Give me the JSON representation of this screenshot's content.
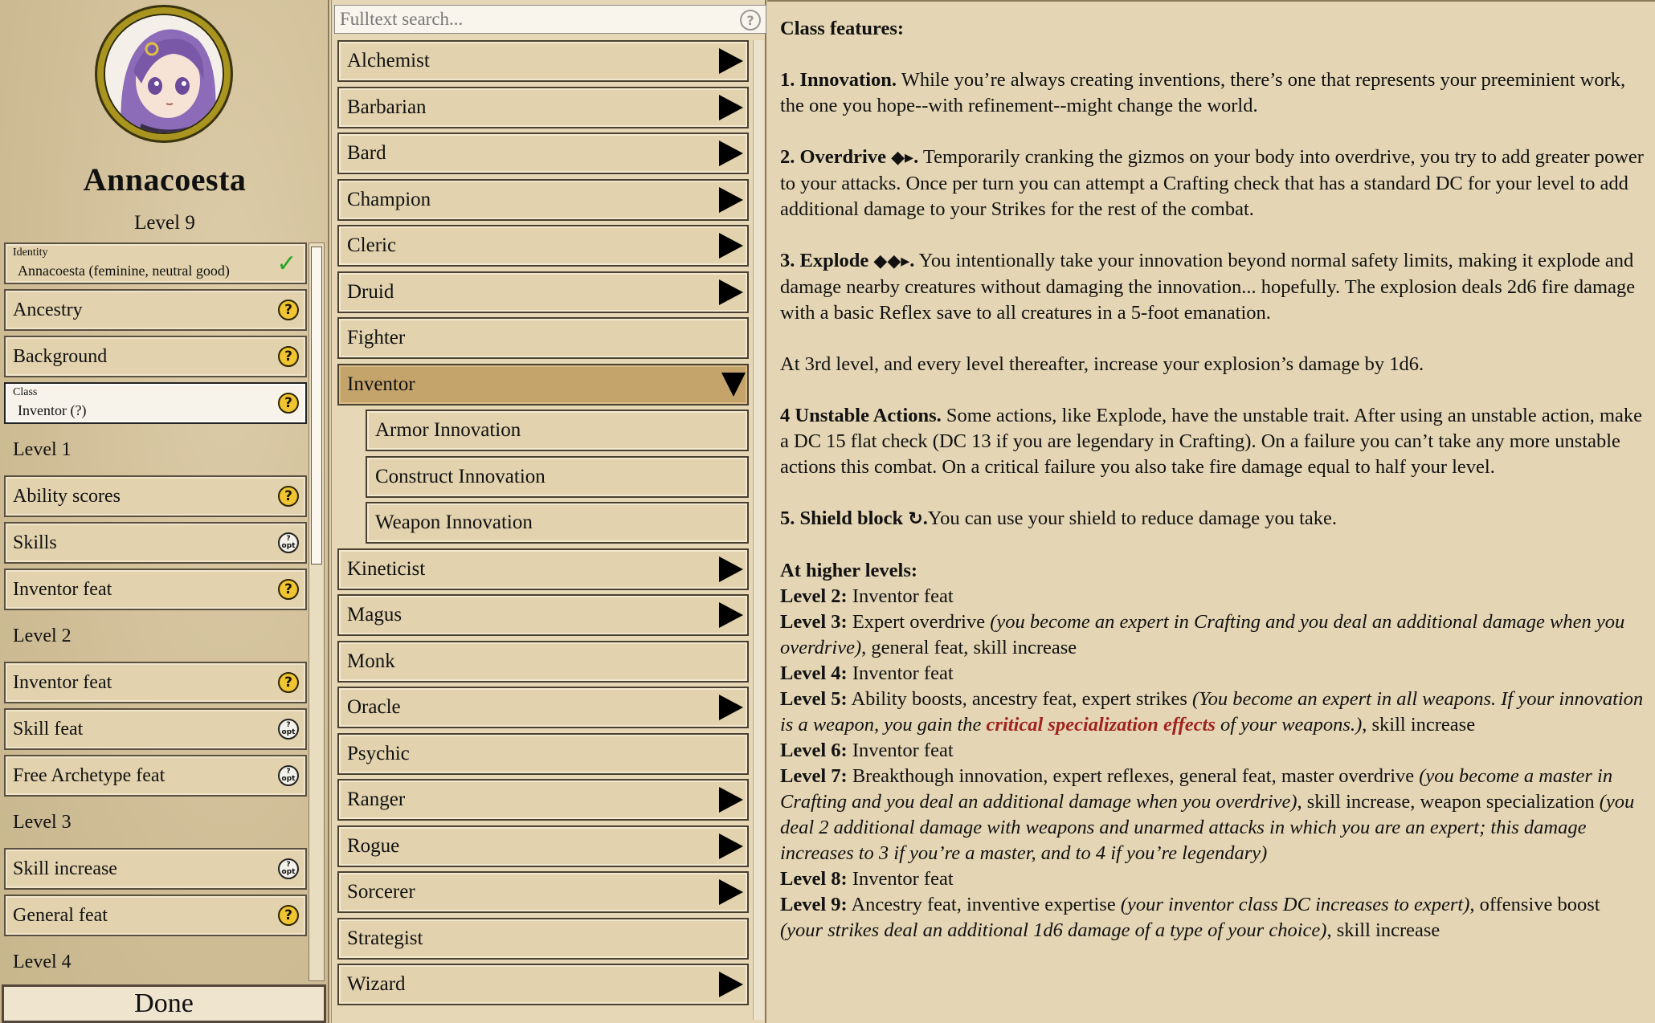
{
  "character": {
    "name": "Annacoesta",
    "level": "Level 9"
  },
  "steps": [
    {
      "caption": "Identity",
      "label": "Annacoesta (feminine, neutral good)",
      "status": "check",
      "style": "two"
    },
    {
      "label": "Ancestry",
      "status": "q"
    },
    {
      "label": "Background",
      "status": "q"
    },
    {
      "caption": "Class",
      "label": "Inventor (?)",
      "status": "q",
      "style": "white"
    },
    {
      "label": "Level 1",
      "style": "heading"
    },
    {
      "label": "Ability scores",
      "status": "q"
    },
    {
      "label": "Skills",
      "status": "opt"
    },
    {
      "label": "Inventor feat",
      "status": "q"
    },
    {
      "label": "Level 2",
      "style": "heading"
    },
    {
      "label": "Inventor feat",
      "status": "q"
    },
    {
      "label": "Skill feat",
      "status": "opt"
    },
    {
      "label": "Free Archetype feat",
      "status": "opt"
    },
    {
      "label": "Level 3",
      "style": "heading"
    },
    {
      "label": "Skill increase",
      "status": "opt"
    },
    {
      "label": "General feat",
      "status": "q"
    },
    {
      "label": "Level 4",
      "style": "heading"
    }
  ],
  "badges": {
    "q": "?",
    "opt_top": "?",
    "opt_bottom": "opt",
    "check": "✓"
  },
  "done_label": "Done",
  "search": {
    "placeholder": "Fulltext search...",
    "help": "?"
  },
  "classes": [
    {
      "label": "Alchemist",
      "arrow": "right"
    },
    {
      "label": "Barbarian",
      "arrow": "right"
    },
    {
      "label": "Bard",
      "arrow": "right"
    },
    {
      "label": "Champion",
      "arrow": "right"
    },
    {
      "label": "Cleric",
      "arrow": "right"
    },
    {
      "label": "Druid",
      "arrow": "right"
    },
    {
      "label": "Fighter",
      "arrow": "none"
    },
    {
      "label": "Inventor",
      "arrow": "down",
      "selected": true
    },
    {
      "label": "Armor Innovation",
      "arrow": "none",
      "sub": true
    },
    {
      "label": "Construct Innovation",
      "arrow": "none",
      "sub": true
    },
    {
      "label": "Weapon Innovation",
      "arrow": "none",
      "sub": true
    },
    {
      "label": "Kineticist",
      "arrow": "right"
    },
    {
      "label": "Magus",
      "arrow": "right"
    },
    {
      "label": "Monk",
      "arrow": "none"
    },
    {
      "label": "Oracle",
      "arrow": "right"
    },
    {
      "label": "Psychic",
      "arrow": "none"
    },
    {
      "label": "Ranger",
      "arrow": "right"
    },
    {
      "label": "Rogue",
      "arrow": "right"
    },
    {
      "label": "Sorcerer",
      "arrow": "right"
    },
    {
      "label": "Strategist",
      "arrow": "none"
    },
    {
      "label": "Wizard",
      "arrow": "right"
    }
  ],
  "details": {
    "heading": "Class features:",
    "f1": {
      "title": "1. Innovation.",
      "text": " While you’re always creating inventions, there’s one that represents your preeminient work, the one you hope--with refinement--might change the world."
    },
    "f2": {
      "title": "2. Overdrive",
      "icon": "◆▸",
      "dot": ".",
      "text": " Temporarily cranking the gizmos on your body into overdrive, you try to add greater power to your attacks. Once per turn you can attempt a Crafting check that has a standard DC for your level to add additional damage to your Strikes for the rest of the combat."
    },
    "f3": {
      "title": "3. Explode",
      "icon": "◆◆▸",
      "dot": ".",
      "text": " You intentionally take your innovation beyond normal safety limits, making it explode and damage nearby creatures without damaging the innovation... hopefully. The explosion deals 2d6 fire damage with a basic Reflex save to all creatures in a 5-foot emanation."
    },
    "f3b": "At 3rd level, and every level thereafter, increase your explosion’s damage by 1d6.",
    "f4": {
      "title": "4 Unstable Actions.",
      "text": " Some actions, like Explode, have the unstable trait. After using an unstable action, make a DC 15 flat check (DC 13 if you are legendary in Crafting). On a failure you can’t take any more unstable actions this combat. On a critical failure you also take fire damage equal to half your level."
    },
    "f5": {
      "title": "5. Shield block",
      "icon": "↻",
      "dot": ".",
      "text": "You can use your shield to reduce damage you take."
    },
    "higher": {
      "heading": "At higher levels:",
      "l2": {
        "label": "Level 2:",
        "text": " Inventor feat"
      },
      "l3": {
        "label": "Level 3:",
        "t1": " Expert overdrive ",
        "i1": "(you become an expert in Crafting and you deal an additional damage when you overdrive)",
        "t2": ", general feat, skill increase"
      },
      "l4": {
        "label": "Level 4:",
        "text": " Inventor feat"
      },
      "l5": {
        "label": "Level 5:",
        "t1": " Ability boosts, ancestry feat, expert strikes ",
        "i1": "(You become an expert in all weapons. If your innovation is a weapon, you gain the ",
        "link": "critical specialization effects",
        "i2": " of your weapons.)",
        "t2": ", skill increase"
      },
      "l6": {
        "label": "Level 6:",
        "text": " Inventor feat"
      },
      "l7": {
        "label": "Level 7:",
        "t1": " Breakthough innovation, expert reflexes, general feat, master overdrive ",
        "i1": "(you become a master in Crafting and you deal an additional damage when you overdrive)",
        "t2": ", skill increase, weapon specialization ",
        "i2": "(you deal 2 additional damage with weapons and unarmed attacks in which you are an expert; this damage increases to 3 if you’re a master, and to 4 if you’re legendary)"
      },
      "l8": {
        "label": "Level 8:",
        "text": " Inventor feat"
      },
      "l9": {
        "label": "Level 9:",
        "t1": " Ancestry feat, inventive expertise ",
        "i1": "(your inventor class DC increases to expert)",
        "t2": ", offensive boost ",
        "i2": "(your strikes deal an additional 1d6 damage of a type of your choice)",
        "t3": ", skill increase"
      }
    }
  }
}
